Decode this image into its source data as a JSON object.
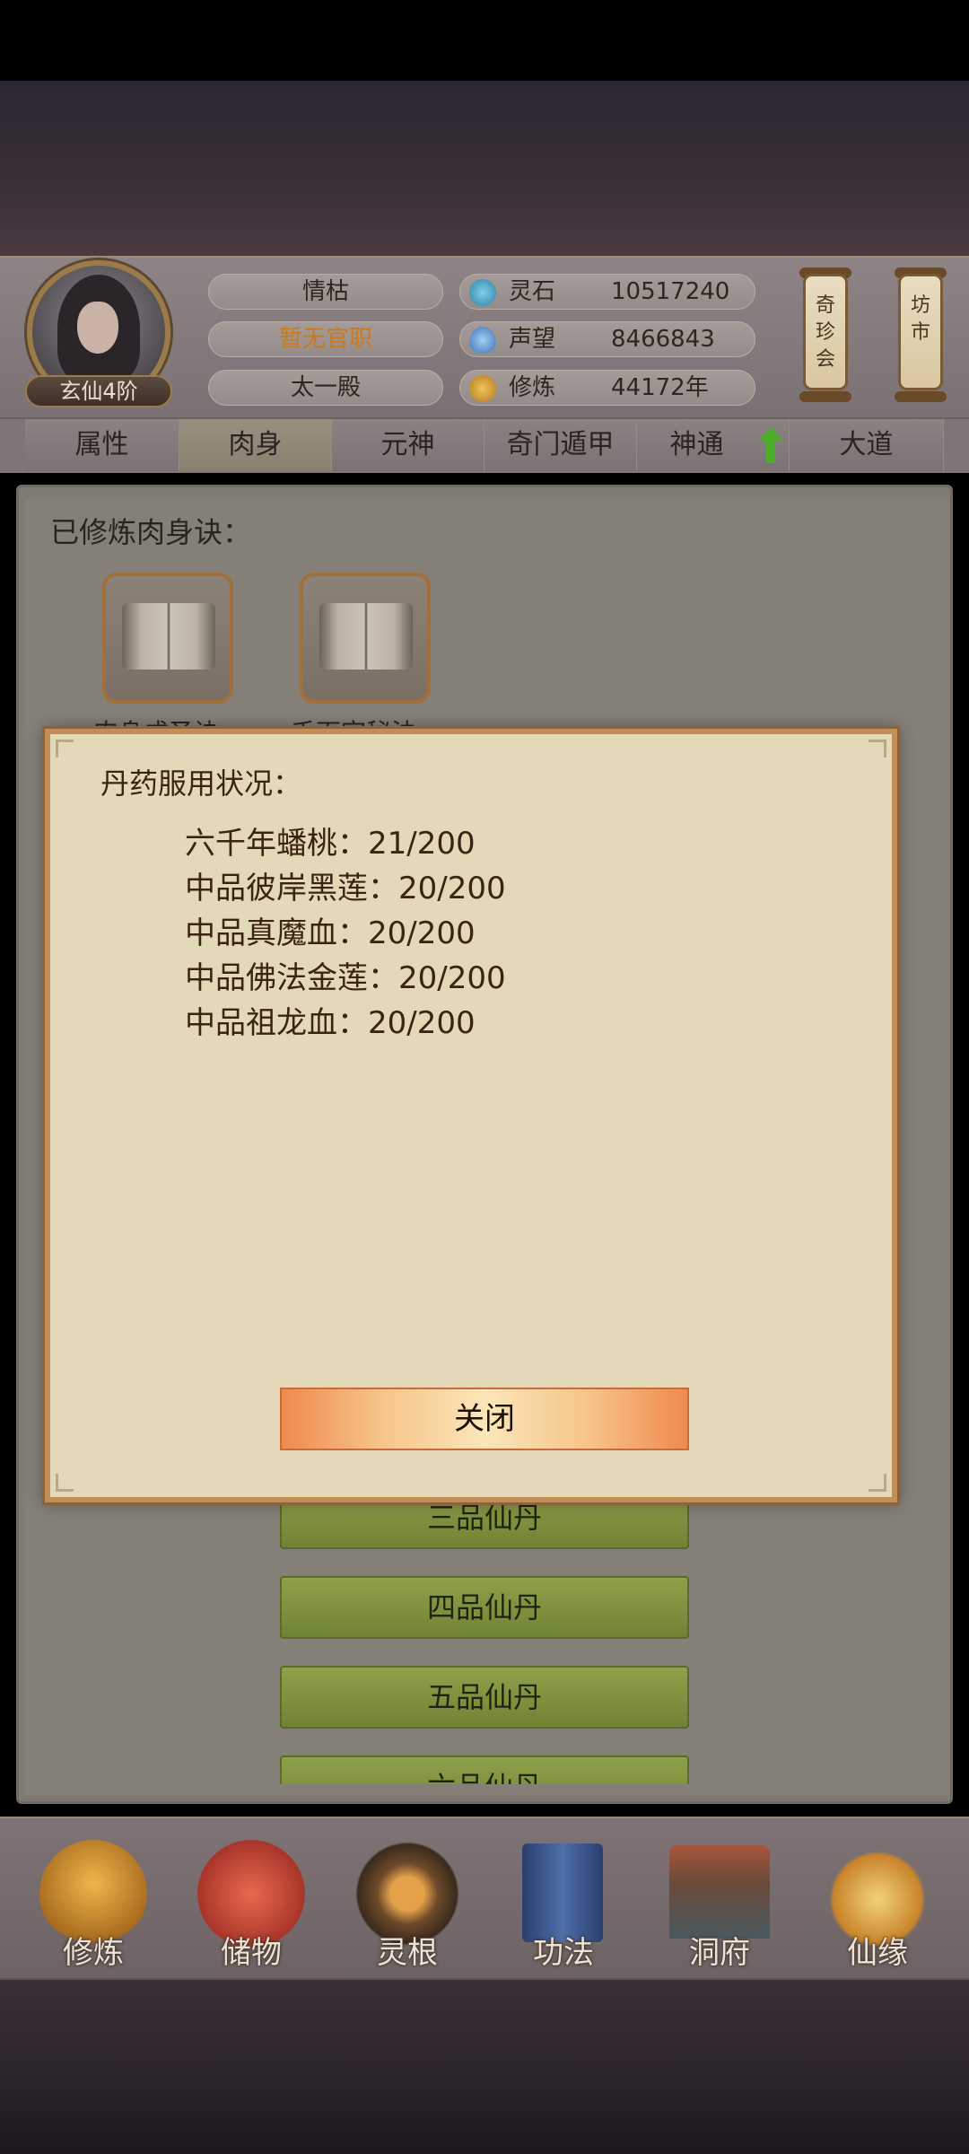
{
  "player": {
    "rank": "玄仙4阶",
    "name": "情枯",
    "office": "暂无官职",
    "sect": "太一殿"
  },
  "resources": [
    {
      "icon": "spirit-stone-icon",
      "label": "灵石",
      "value": "10517240"
    },
    {
      "icon": "prestige-icon",
      "label": "声望",
      "value": "8466843"
    },
    {
      "icon": "cultivation-icon",
      "label": "修炼",
      "value": "44172年"
    }
  ],
  "side_buttons": {
    "treasure": "奇珍会",
    "market": "坊市"
  },
  "tabs": [
    "属性",
    "肉身",
    "元神",
    "奇门遁甲",
    "神通",
    "大道"
  ],
  "active_tab": "肉身",
  "panel": {
    "title": "已修炼肉身诀：",
    "books": [
      "肉身成圣诀",
      "千面宗秘法"
    ]
  },
  "pill_buttons": [
    "三品仙丹",
    "四品仙丹",
    "五品仙丹",
    "六品仙丹"
  ],
  "bottom_nav": [
    "修炼",
    "储物",
    "灵根",
    "功法",
    "洞府",
    "仙缘"
  ],
  "modal": {
    "title": "丹药服用状况：",
    "items": [
      "六千年蟠桃：21/200",
      "中品彼岸黑莲：20/200",
      "中品真魔血：20/200",
      "中品佛法金莲：20/200",
      "中品祖龙血：20/200"
    ],
    "close_label": "关闭"
  },
  "colors": {
    "modal_bg": "#e3d8b7",
    "modal_border": "#c28e57",
    "office_text": "#c97a1d",
    "pill_button": "#7a8e3c"
  }
}
